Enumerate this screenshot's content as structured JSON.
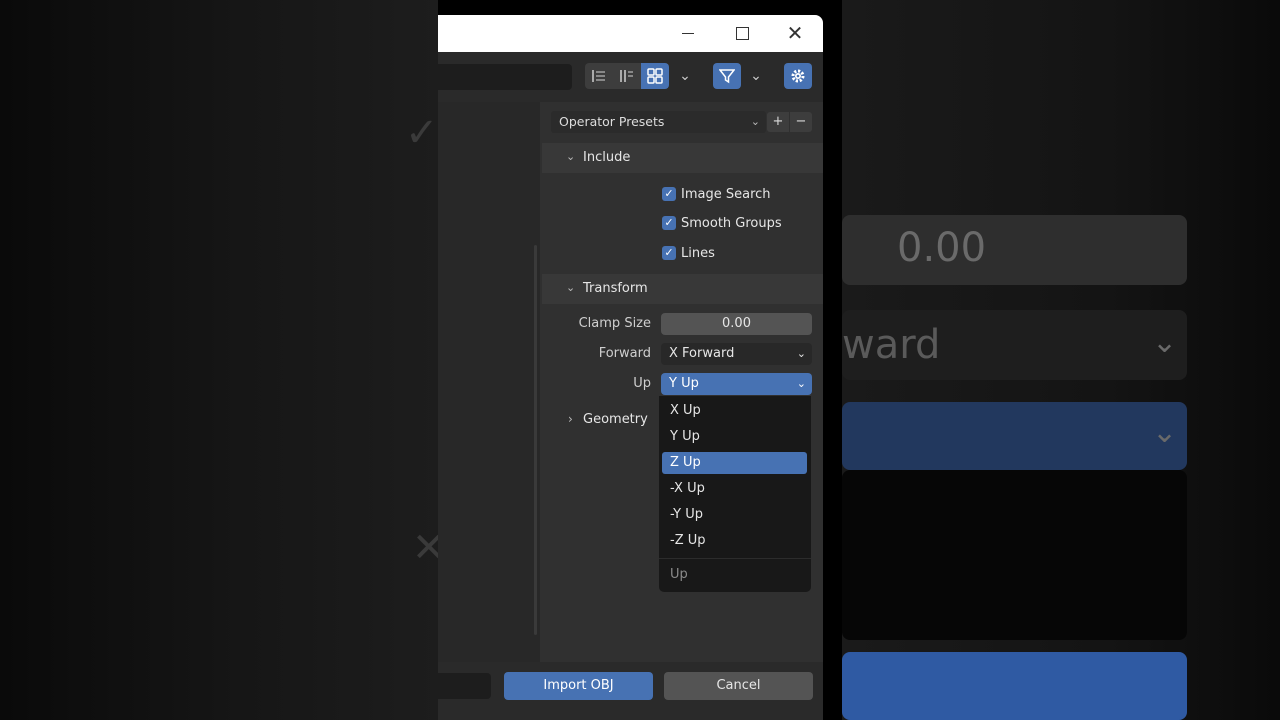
{
  "background": {
    "left_ghost_1": "✓",
    "left_ghost_2": "✕",
    "right_number": "0.00",
    "right_forward": "ward"
  },
  "window": {
    "controls": {
      "minimize": "",
      "maximize": "",
      "close": "✕"
    }
  },
  "toolbar": {
    "icons": [
      "list-vertical-icon",
      "list-horizontal-icon",
      "grid-icon",
      "chevron-down-icon",
      "filter-icon",
      "chevron-down-icon",
      "gear-icon"
    ]
  },
  "presets": {
    "label": "Operator Presets",
    "add": "+",
    "remove": "−"
  },
  "include": {
    "title": "Include",
    "options": [
      {
        "label": "Image Search",
        "checked": true
      },
      {
        "label": "Smooth Groups",
        "checked": true
      },
      {
        "label": "Lines",
        "checked": true
      }
    ]
  },
  "transform": {
    "title": "Transform",
    "clamp_label": "Clamp Size",
    "clamp_value": "0.00",
    "forward_label": "Forward",
    "forward_value": "X Forward",
    "up_label": "Up",
    "up_value": "Y Up"
  },
  "geometry": {
    "title": "Geometry"
  },
  "up_dropdown": {
    "items": [
      "X Up",
      "Y Up",
      "Z Up",
      "-X Up",
      "-Y Up",
      "-Z Up"
    ],
    "highlighted": "Z Up",
    "title": "Up"
  },
  "footer": {
    "import_label": "Import OBJ",
    "cancel_label": "Cancel"
  },
  "colors": {
    "accent": "#4772b3",
    "panel": "#303030",
    "field": "#545454"
  }
}
